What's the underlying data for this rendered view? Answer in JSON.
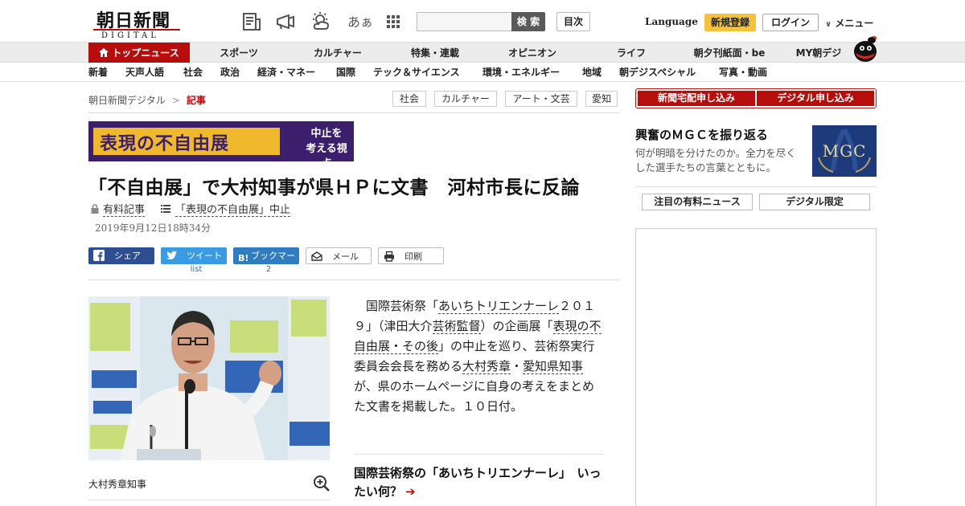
{
  "header": {
    "logo_main": "朝日新聞",
    "logo_sub": "DIGITAL",
    "font_icon": "あぁ",
    "search_button": "検 索",
    "search_placeholder": "",
    "toc_button": "目次",
    "language": "Language",
    "signup": "新規登録",
    "login": "ログイン",
    "menu": "メニュー",
    "icons": [
      "newspaper-icon",
      "megaphone-icon",
      "weather-icon",
      "font-size-icon",
      "grid-icon",
      "chevron-down-icon"
    ]
  },
  "nav_primary": [
    "トップニュース",
    "スポーツ",
    "カルチャー",
    "特集・連載",
    "オピニオン",
    "ライフ",
    "朝夕刊紙面・be",
    "MY朝デジ"
  ],
  "nav_secondary": [
    "新着",
    "天声人語",
    "社会",
    "政治",
    "経済・マネー",
    "国際",
    "テック＆サイエンス",
    "環境・エネルギー",
    "地域",
    "朝デジスペシャル",
    "写真・動画"
  ],
  "breadcrumb": {
    "home": "朝日新聞デジタル",
    "separator": ">",
    "current": "記事"
  },
  "tags": [
    "社会",
    "カルチャー",
    "アート・文芸",
    "愛知"
  ],
  "banner": {
    "title": "表現の不自由展",
    "sub_line1": "中止を",
    "sub_line2": "考える視点"
  },
  "article": {
    "headline": "「不自由展」で大村知事が県ＨＰに文書　河村市長に反論",
    "paid_label": "有料記事",
    "series_label": "「表現の不自由展」中止",
    "date": "2019年9月12日18時34分",
    "share": {
      "facebook": "シェア",
      "twitter": "ツイート",
      "hatena": "ブックマーク",
      "mail": "メール",
      "print": "印刷",
      "twitter_count": "list",
      "hatena_count": "2"
    },
    "photo_caption": "大村秀章知事",
    "body": {
      "p1": "国際芸術祭「",
      "l1": "あいちトリエンナーレ",
      "p2": "２０１９」（津田大介",
      "l2": "芸術監督",
      "p3": "）の企画展「",
      "l3": "表現の不自由展・その後",
      "p4": "」の中止を巡り、芸術祭実行委員会会長を務める",
      "l4": "大村秀章",
      "p5": "・",
      "l5": "愛知県知事",
      "p6": "が、県のホームページに自身の考えをまとめた文書を掲載した。１０日付。"
    },
    "related_title": "国際芸術祭の「あいちトリエンナーレ」　いったい何？",
    "related_arrow": "➔"
  },
  "sidebar": {
    "sub_paper": "新聞宅配申し込み",
    "sub_digital": "デジタル申し込み",
    "promo_title": "興奮のＭＧＣを振り返る",
    "promo_desc": "何が明暗を分けたのか。全力を尽くした選手たちの言葉とともに。",
    "promo_img_text": "MGC",
    "tab_paid": "注目の有料ニュース",
    "tab_digital": "デジタル限定"
  },
  "colors": {
    "brand_red": "#b80d0d",
    "signup_yellow": "#f5c33b",
    "facebook": "#2e4e92",
    "twitter": "#3a9ae2",
    "hatena": "#2f7cc1",
    "banner_purple": "#3b1f6d",
    "banner_gold": "#f0b82d"
  }
}
